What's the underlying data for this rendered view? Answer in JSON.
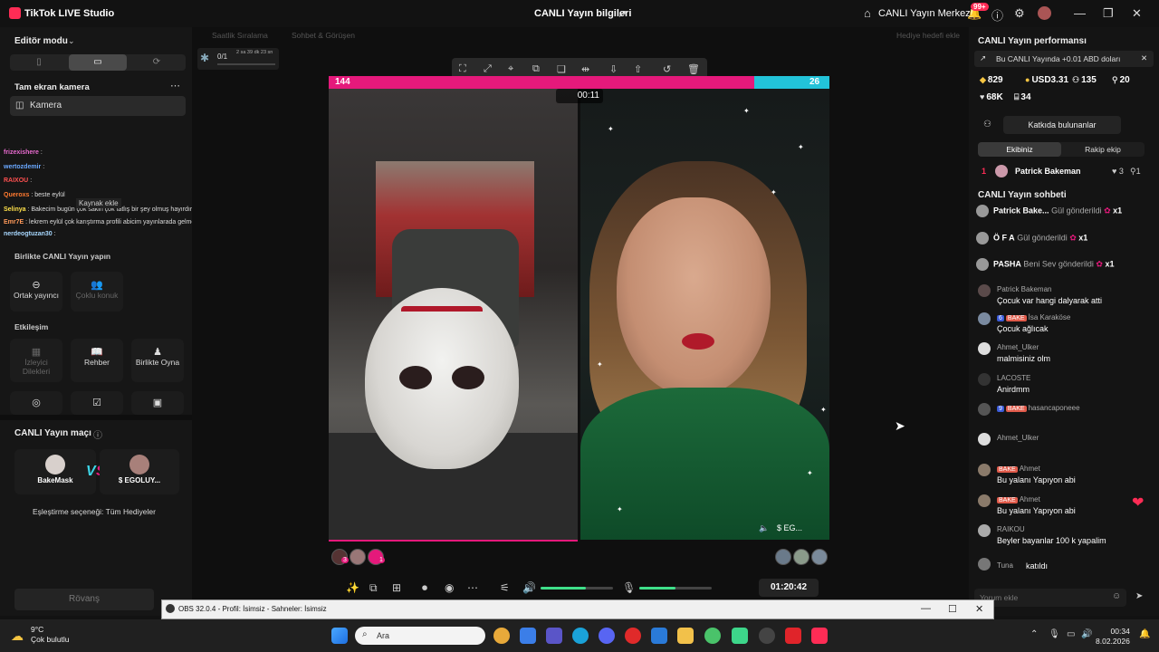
{
  "titlebar": {
    "app_title": "TikTok LIVE Studio",
    "center_title": "CANLI Yayın bilgileri",
    "hub_label": "CANLI Yayın Merkezi",
    "notif_badge": "99+"
  },
  "left": {
    "editor_mode": "Editör modu",
    "fullscreen_camera": "Tam ekran kamera",
    "camera_item": "Kamera",
    "source_add_tooltip": "Kaynak ekle",
    "overlay_chat": [
      {
        "name": "frizexishere",
        "text": ":"
      },
      {
        "name": "wertozdemir",
        "text": ":"
      },
      {
        "name": "RAIXOU",
        "text": ":"
      },
      {
        "name": "Queroxs",
        "text": ": beste eylül"
      },
      {
        "name": "Selinya",
        "text": ": Bakecim bugün çok sakin çok tatlış bir şey olmuş hayırdır inşallah"
      },
      {
        "name": "Emr7E",
        "text": ": lekrem eylül çok karıştırma profili abicim yayınlarada gelmesin"
      },
      {
        "name": "nerdeogtuzan30",
        "text": ":"
      }
    ],
    "together_title": "Birlikte CANLI Yayın yapın",
    "together_tiles": [
      "Ortak yayıncı",
      "Çoklu konuk"
    ],
    "interaction_title": "Etkileşim",
    "interaction_tiles": [
      "İzleyici Dilekleri",
      "Rehber",
      "Birlikte Oyna"
    ],
    "match_title": "CANLI Yayın maçı",
    "match_left": "BakeMask",
    "match_right": "$ EGOLUY...",
    "match_option": "Eşleştirme seçeneği: Tüm Hediyeler",
    "rematch": "Rövanş"
  },
  "center": {
    "gift_tabs": [
      "Saatlik Sıralama",
      "Sohbet & Görüşen"
    ],
    "gift_goal": "Hediye hedefi ekle",
    "goal_count": "0/1",
    "goal_time": "2 sa 39 dk 23 sn",
    "score_left": "144",
    "score_right": "26",
    "battle_timer": "00:11",
    "opponent_label": "EG...",
    "gift_counts": [
      "3",
      "1"
    ],
    "elapsed": "01:20:42",
    "volume_level": 0.62,
    "mic_level": 0.5
  },
  "right": {
    "perf_title": "CANLI Yayın performansı",
    "notice": "Bu CANLI Yayında +0.01 ABD doları",
    "stats": {
      "diamonds": "829",
      "usd": "USD3.31",
      "viewers": "135",
      "gifters": "20",
      "likes": "68K",
      "shares": "34"
    },
    "contributors": "Katkıda bulunanlar",
    "team_tabs": [
      "Ekibiniz",
      "Rakip ekip"
    ],
    "top_rank": {
      "pos": "1",
      "name": "Patrick Bakeman",
      "likes": "3",
      "gifts": "1"
    },
    "chat_title": "CANLI Yayın sohbeti",
    "gift_msgs": [
      {
        "name": "Patrick Bake...",
        "action": "Gül gönderildi",
        "count": "x1"
      },
      {
        "name": "Ö F A",
        "action": "Gül gönderildi",
        "count": "x1"
      },
      {
        "name": "PASHA",
        "action": "Beni Sev gönderildi",
        "count": "x1"
      }
    ],
    "comments": [
      {
        "name": "Patrick Bakeman",
        "text": "Çocuk var hangi dalyarak atti"
      },
      {
        "name": "İsa Karaköse",
        "text": "Çocuk ağlıcak",
        "level": "6",
        "fan": "BAKE"
      },
      {
        "name": "Ahmet_Ulker",
        "text": "malmisiniz olm"
      },
      {
        "name": "LACOSTE",
        "text": "Anirdmm"
      },
      {
        "name": "hasancaponeee",
        "text": "",
        "level": "9",
        "fan": "BAKE"
      },
      {
        "name": "Ahmet_Ulker",
        "text": ""
      },
      {
        "name": "Ahmet",
        "text": "Bu yalanı Yapıyon abi",
        "fan": "BAKE"
      },
      {
        "name": "Ahmet",
        "text": "Bu yalanı Yapıyon abi",
        "fan": "BAKE"
      },
      {
        "name": "RAIKOU",
        "text": "Beyler bayanlar 100 k yapalim"
      },
      {
        "name": "Tuna",
        "text": "katıldı"
      }
    ],
    "comment_placeholder": "Yorum ekle"
  },
  "obs": {
    "title": "OBS 32.0.4 - Profil: İsimsiz - Sahneler: İsimsiz"
  },
  "taskbar": {
    "temp": "9°C",
    "weather": "Çok bulutlu",
    "search": "Ara",
    "time": "00:34",
    "date": "8.02.2026"
  },
  "colors": {
    "accent": "#fe2c55",
    "team_pink": "#e5197b",
    "team_cyan": "#22c3d9",
    "level_green": "#3fe08a"
  }
}
